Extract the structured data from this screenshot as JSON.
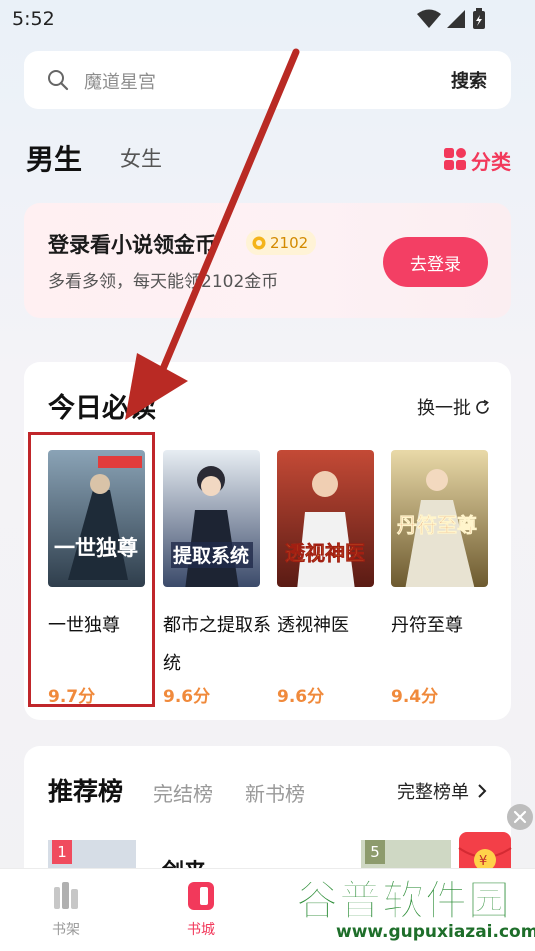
{
  "status_bar": {
    "time": "5:52"
  },
  "search": {
    "placeholder": "魔道星宫",
    "button_label": "搜索"
  },
  "gender_tabs": {
    "male": "男生",
    "female": "女生"
  },
  "category": {
    "label": "分类",
    "color": "#f2395b"
  },
  "login_banner": {
    "title": "登录看小说领金币",
    "coin_badge": "2102",
    "subtitle": "多看多领，每天能领2102金币",
    "button_label": "去登录"
  },
  "daily_reads": {
    "title": "今日必读",
    "refresh_label": "换一批",
    "books": [
      {
        "title": "一世独尊",
        "score": "9.7分",
        "cover_text": "一世独尊"
      },
      {
        "title": "都市之提取系统",
        "score": "9.6分",
        "cover_text": "提取系统"
      },
      {
        "title": "透视神医",
        "score": "9.6分",
        "cover_text": "透视神医"
      },
      {
        "title": "丹符至尊",
        "score": "9.4分",
        "cover_text": "丹符至尊"
      }
    ]
  },
  "rankings": {
    "tabs": [
      "推荐榜",
      "完结榜",
      "新书榜"
    ],
    "full_list_label": "完整榜单",
    "items": [
      {
        "rank": "1",
        "title": "剑来"
      },
      {
        "rank": "5"
      }
    ]
  },
  "bottom_nav": {
    "items": [
      {
        "label": "书架",
        "active": false
      },
      {
        "label": "书城",
        "active": true
      }
    ]
  },
  "watermark": {
    "title": "谷普软件园",
    "url": "www.gupuxiazai.com"
  },
  "colors": {
    "accent": "#f2395b",
    "score": "#f08a3c",
    "annotation": "#c0262a"
  }
}
